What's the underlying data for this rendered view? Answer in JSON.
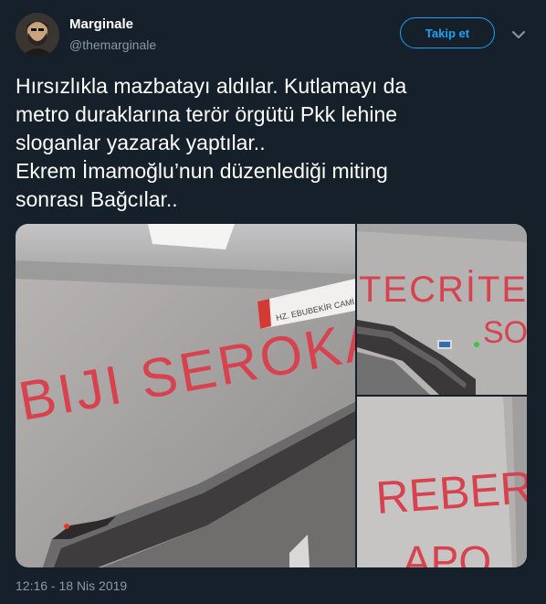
{
  "user": {
    "display_name": "Marginale",
    "handle": "@themarginale",
    "avatar": "avatar-photo"
  },
  "follow_button": {
    "label": "Takip et"
  },
  "menu_icon": "chevron-down-icon",
  "tweet": {
    "lines": [
      "Hırsızlıkla mazbatayı aldılar. Kutlamayı da",
      "metro duraklarına terör örgütü Pkk lehine",
      "sloganlar yazarak yaptılar..",
      "Ekrem İmamoğlu’nun düzenlediği miting",
      "sonrası Bağcılar.."
    ]
  },
  "media": {
    "photo_1": {
      "sign_text": "HZ. EBUBEKİR CAMİ",
      "graffiti": "BIJI SEROKA"
    },
    "photo_2": {
      "graffiti": "TECRİTE",
      "graffiti_2": "SON"
    },
    "photo_3": {
      "graffiti": "REBER",
      "graffiti_2": "APO"
    }
  },
  "timestamp": "12:16 - 18 Nis 2019",
  "colors": {
    "background": "#15202b",
    "accent": "#1da1f2",
    "secondary_text": "#8899a6",
    "graffiti": "#d8424f"
  }
}
